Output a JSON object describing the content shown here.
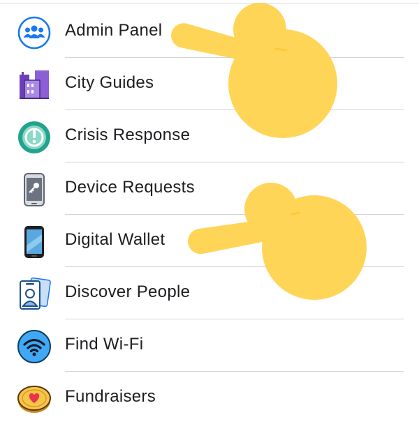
{
  "menu": {
    "items": [
      {
        "label": "Admin Panel",
        "icon": "admin-panel-icon"
      },
      {
        "label": "City Guides",
        "icon": "city-guides-icon"
      },
      {
        "label": "Crisis Response",
        "icon": "crisis-response-icon"
      },
      {
        "label": "Device Requests",
        "icon": "device-requests-icon"
      },
      {
        "label": "Digital Wallet",
        "icon": "digital-wallet-icon"
      },
      {
        "label": "Discover People",
        "icon": "discover-people-icon"
      },
      {
        "label": "Find Wi-Fi",
        "icon": "find-wifi-icon"
      },
      {
        "label": "Fundraisers",
        "icon": "fundraisers-icon"
      }
    ]
  },
  "overlays": [
    {
      "name": "pointing-hand-emoji",
      "target": "Admin Panel"
    },
    {
      "name": "pointing-hand-emoji",
      "target": "Digital Wallet"
    }
  ],
  "colors": {
    "text": "#1c1e21",
    "divider": "#d3d4d8",
    "facebook_blue": "#1877f2",
    "crisis_teal": "#23a38e",
    "city_purple": "#7b4fc7",
    "hand_yellow": "#ffd558"
  }
}
